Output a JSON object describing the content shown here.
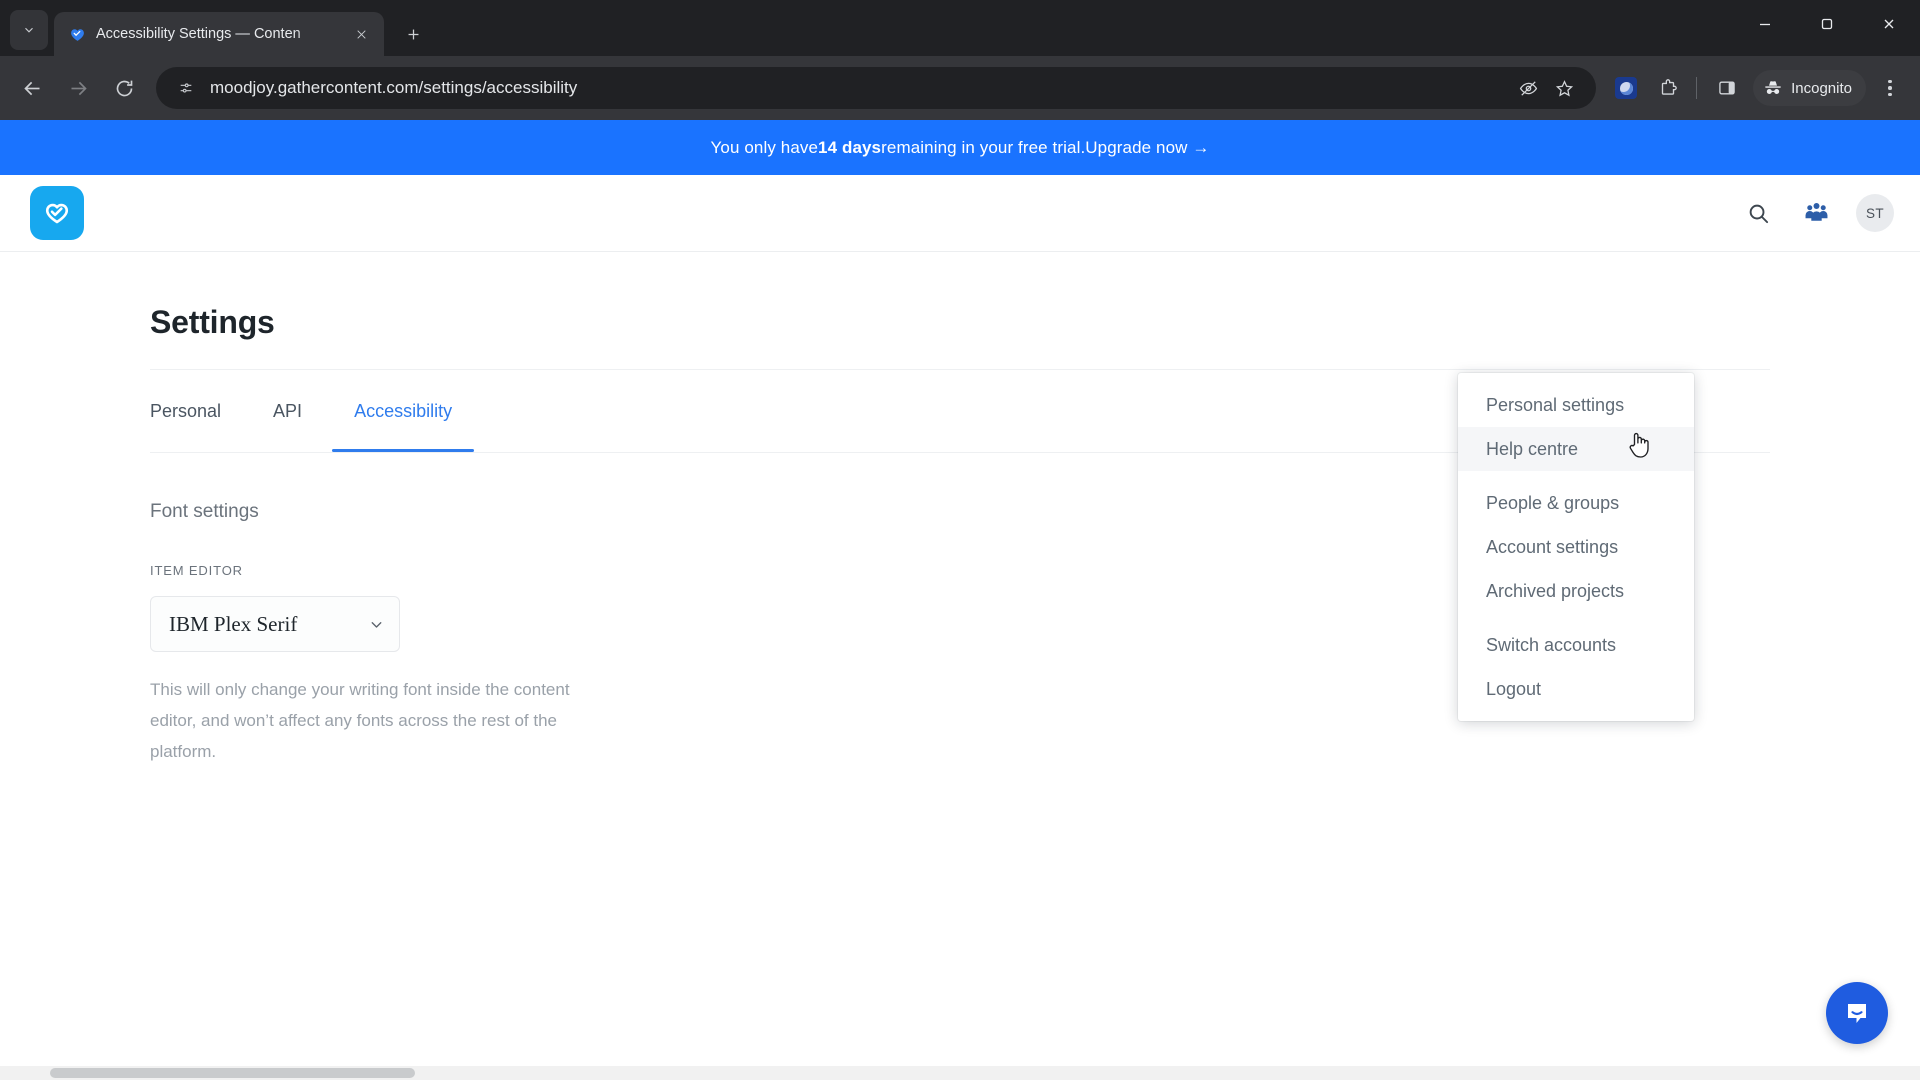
{
  "browser": {
    "tab": {
      "title": "Accessibility Settings — Conten",
      "favicon_name": "gathercontent-favicon"
    },
    "new_tab_label": "+",
    "url": "moodjoy.gathercontent.com/settings/accessibility",
    "profile_label": "Incognito",
    "icons": {
      "tab_search": "tab-search-icon",
      "close_tab": "close-icon",
      "back": "back-arrow-icon",
      "forward": "forward-arrow-icon",
      "reload": "reload-icon",
      "site_info": "site-settings-icon",
      "tracking": "eye-off-icon",
      "bookmark": "star-icon",
      "extension_active": "extension-active-icon",
      "extensions": "puzzle-piece-icon",
      "side_panel": "side-panel-icon",
      "incognito": "incognito-hat-icon",
      "menu": "three-dot-menu-icon",
      "minimize": "minimize-icon",
      "maximize": "maximize-icon",
      "close_window": "window-close-icon"
    }
  },
  "banner": {
    "prefix": "You only have ",
    "days": "14 days",
    "suffix": " remaining in your free trial. ",
    "cta": "Upgrade now →",
    "background": "#1a73ff"
  },
  "app_header": {
    "logo_name": "gathercontent-logo",
    "search_icon": "search-icon",
    "people_icon": "people-group-icon",
    "avatar_initials": "ST"
  },
  "settings": {
    "page_title": "Settings",
    "tabs": [
      {
        "label": "Personal",
        "active": false
      },
      {
        "label": "API",
        "active": false
      },
      {
        "label": "Accessibility",
        "active": true
      }
    ],
    "active_tab_color": "#2f7ced",
    "section_title": "Font settings",
    "field_label": "ITEM EDITOR",
    "font_select_value": "IBM Plex Serif",
    "chevron_icon": "chevron-down-icon",
    "help_text": "This will only change your writing font inside the content editor, and won’t affect any fonts across the rest of the platform."
  },
  "account_menu": {
    "items": [
      {
        "label": "Personal settings",
        "hovered": false
      },
      {
        "label": "Help centre",
        "hovered": true
      },
      {
        "label": "People & groups",
        "hovered": false
      },
      {
        "label": "Account settings",
        "hovered": false
      },
      {
        "label": "Archived projects",
        "hovered": false
      },
      {
        "label": "Switch accounts",
        "hovered": false
      },
      {
        "label": "Logout",
        "hovered": false
      }
    ]
  },
  "intercom": {
    "icon_name": "intercom-chat-icon",
    "color": "#1f5ce0"
  }
}
